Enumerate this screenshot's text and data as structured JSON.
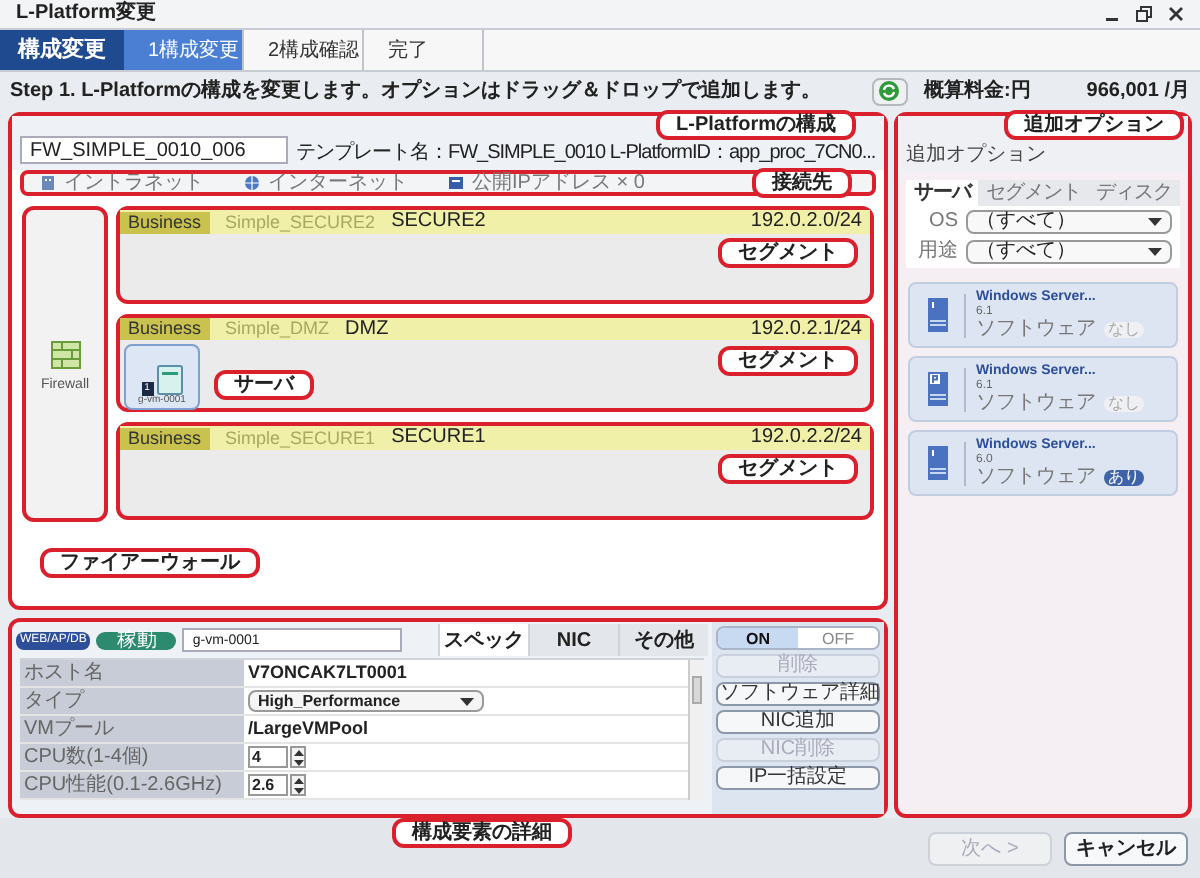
{
  "window": {
    "title": "L-Platform変更"
  },
  "steps": {
    "heading": "構成変更",
    "items": [
      {
        "label": "1構成変更",
        "selected": true
      },
      {
        "label": "2構成確認",
        "selected": false
      },
      {
        "label": "完了",
        "selected": false
      }
    ]
  },
  "instruction": "Step 1. L-Platformの構成を変更します。オプションはドラッグ＆ドロップで追加します。",
  "cost": {
    "label": "概算料金:円",
    "value": "966,001 /月"
  },
  "platform": {
    "callout": "L-Platformの構成",
    "name": "FW_SIMPLE_0010_006",
    "template_info": "テンプレート名：FW_SIMPLE_0010  L-PlatformID：app_proc_7CN0...",
    "connections_callout": "接続先",
    "connections": [
      {
        "kind": "intranet",
        "label": "イントラネット"
      },
      {
        "kind": "internet",
        "label": "インターネット"
      },
      {
        "kind": "public_ip",
        "label": "公開IPアドレス × 0"
      }
    ],
    "firewall": {
      "label": "Firewall",
      "callout": "ファイアーウォール"
    },
    "segments": [
      {
        "tag": "Business",
        "template": "Simple_SECURE2",
        "name": "SECURE2",
        "address": "192.0.2.0/24",
        "callout": "セグメント"
      },
      {
        "tag": "Business",
        "template": "Simple_DMZ",
        "name": "DMZ",
        "address": "192.0.2.1/24",
        "callout": "セグメント",
        "servers": [
          {
            "name": "g-vm-0001",
            "badge": "1",
            "callout": "サーバ"
          }
        ]
      },
      {
        "tag": "Business",
        "template": "Simple_SECURE1",
        "name": "SECURE1",
        "address": "192.0.2.2/24",
        "callout": "セグメント"
      }
    ]
  },
  "detail": {
    "callout": "構成要素の詳細",
    "role": "WEB/AP/DB",
    "status": "稼動",
    "name": "g-vm-0001",
    "tabs": [
      {
        "label": "スペック",
        "selected": true
      },
      {
        "label": "NIC",
        "selected": false
      },
      {
        "label": "その他",
        "selected": false
      }
    ],
    "fields": [
      {
        "label": "ホスト名",
        "kind": "text",
        "value": "V7ONCAK7LT0001"
      },
      {
        "label": "タイプ",
        "kind": "select",
        "value": "High_Performance"
      },
      {
        "label": "VMプール",
        "kind": "text",
        "value": "/LargeVMPool"
      },
      {
        "label": "CPU数(1-4個)",
        "kind": "spinner",
        "value": "4"
      },
      {
        "label": "CPU性能(0.1-2.6GHz)",
        "kind": "spinner",
        "value": "2.6"
      }
    ],
    "power": {
      "on_label": "ON",
      "off_label": "OFF",
      "on": true
    },
    "actions": [
      {
        "label": "削除",
        "disabled": true
      },
      {
        "label": "ソフトウェア詳細",
        "disabled": false
      },
      {
        "label": "NIC追加",
        "disabled": false
      },
      {
        "label": "NIC削除",
        "disabled": true
      },
      {
        "label": "IP一括設定",
        "disabled": false
      }
    ]
  },
  "options": {
    "callout": "追加オプション",
    "title": "追加オプション",
    "tabs": [
      {
        "label": "サーバ",
        "selected": true
      },
      {
        "label": "セグメント",
        "selected": false
      },
      {
        "label": "ディスク",
        "selected": false
      }
    ],
    "filters": [
      {
        "label": "OS",
        "value": "（すべて）"
      },
      {
        "label": "用途",
        "value": "（すべて）"
      }
    ],
    "items": [
      {
        "kind": "server",
        "name": "Windows Server...",
        "version": "6.1",
        "type": "ソフトウェア",
        "software": "なし",
        "has_software": false
      },
      {
        "kind": "physical_server",
        "name": "Windows Server...",
        "version": "6.1",
        "type": "ソフトウェア",
        "software": "なし",
        "has_software": false
      },
      {
        "kind": "server",
        "name": "Windows Server...",
        "version": "6.0",
        "type": "ソフトウェア",
        "software": "あり",
        "has_software": true
      }
    ]
  },
  "footer": {
    "buttons": [
      {
        "label": "次へ >",
        "disabled": true
      },
      {
        "label": "キャンセル",
        "disabled": false
      }
    ]
  }
}
